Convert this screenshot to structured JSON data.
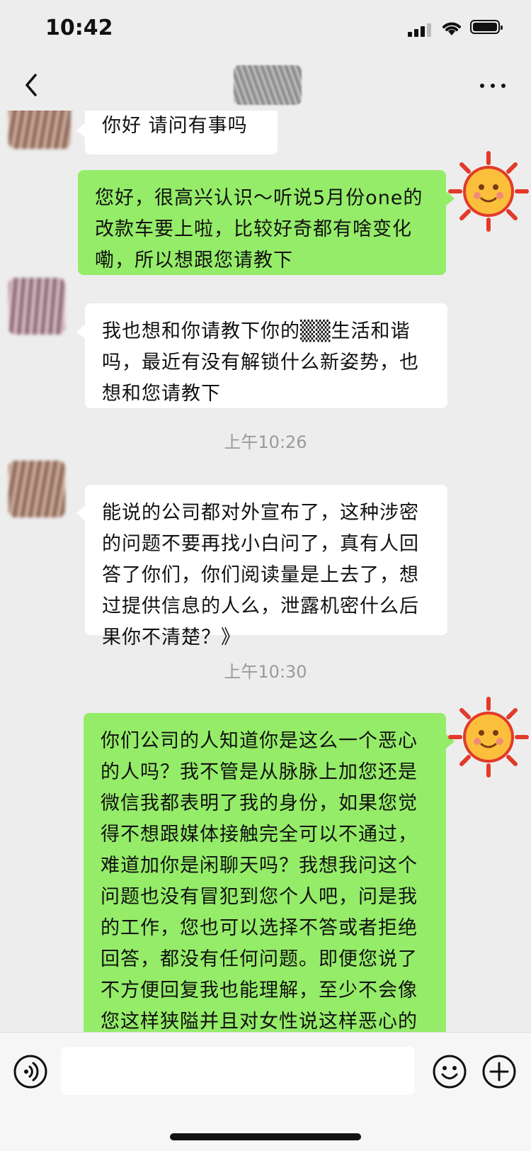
{
  "status": {
    "time": "10:42"
  },
  "nav": {
    "back_icon": "chevron-left-icon",
    "more_icon": "more-dots-icon"
  },
  "messages": [
    {
      "side": "left",
      "text": "你好 请问有事吗"
    },
    {
      "side": "right",
      "text": "您好，很高兴认识～听说5月份one的改款车要上啦，比较好奇都有啥变化嘞，所以想跟您请教下"
    },
    {
      "side": "left",
      "text": "我也想和你请教下你的▒▒生活和谐吗，最近有没有解锁什么新姿势，也想和您请教下"
    },
    {
      "type": "timestamp",
      "text": "上午10:26"
    },
    {
      "side": "left",
      "text": "能说的公司都对外宣布了，这种涉密的问题不要再找小白问了，真有人回答了你们，你们阅读量是上去了，想过提供信息的人么，泄露机密什么后果你不清楚？》"
    },
    {
      "type": "timestamp",
      "text": "上午10:30"
    },
    {
      "side": "right",
      "text": "你们公司的人知道你是这么一个恶心的人吗？我不管是从脉脉上加您还是微信我都表明了我的身份，如果您觉得不想跟媒体接触完全可以不通过，难道加你是闲聊天吗？我想我问这个问题也没有冒犯到您个人吧，问是我的工作，您也可以选择不答或者拒绝回答，都没有任何问题。即便您说了不方便回复我也能理解，至少不会像您这样狭隘并且对女性说这样恶心的话。理想能"
    }
  ],
  "input": {
    "value": "",
    "voice_icon": "voice-icon",
    "emoji_icon": "emoji-icon",
    "plus_icon": "plus-icon"
  },
  "colors": {
    "background": "#ededed",
    "bubble_left": "#ffffff",
    "bubble_right": "#95ec69",
    "timestamp": "#9a9a9a"
  }
}
